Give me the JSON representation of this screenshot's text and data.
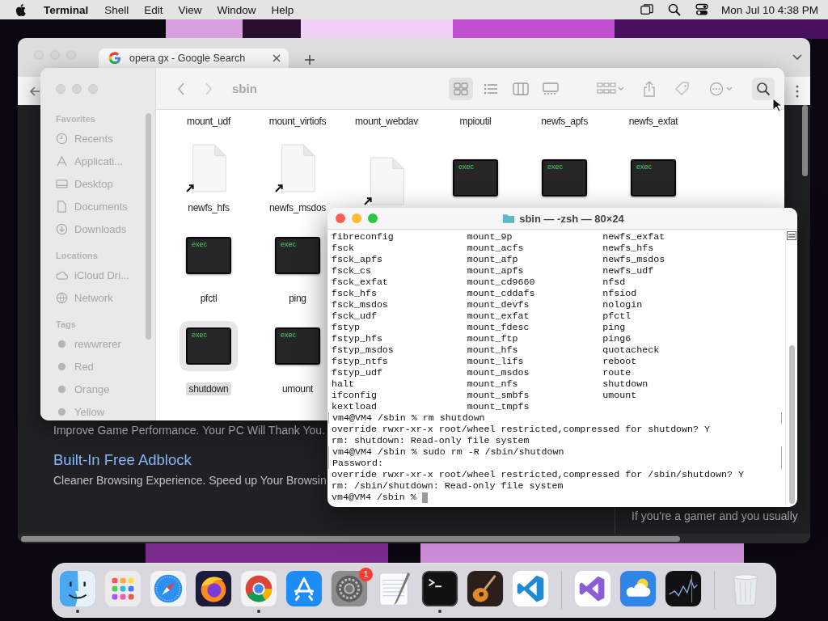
{
  "menu_bar": {
    "app_name": "Terminal",
    "menus": [
      "Shell",
      "Edit",
      "View",
      "Window",
      "Help"
    ],
    "clock": "Mon Jul 10  4:38 PM"
  },
  "browser": {
    "tab": {
      "title": "opera gx - Google Search"
    },
    "snippets": [
      {
        "kind": "text",
        "text": "Improve Game Performance. Your PC Will Thank You."
      },
      {
        "kind": "link",
        "text": "Built-In Free Adblock"
      },
      {
        "kind": "text",
        "text": "Cleaner Browsing Experience. Speed up Your Browsin"
      }
    ],
    "side_text": "If you're a gamer and you usually"
  },
  "finder": {
    "title": "sbin",
    "views": [
      {
        "kind": "grid",
        "selected": true
      },
      {
        "kind": "list",
        "selected": false
      },
      {
        "kind": "columns",
        "selected": false
      },
      {
        "kind": "gallery",
        "selected": false
      }
    ],
    "sidebar": [
      {
        "heading": "Favorites",
        "items": [
          {
            "kind": "clock",
            "label": "Recents"
          },
          {
            "kind": "apps",
            "label": "Applicati..."
          },
          {
            "kind": "desktop",
            "label": "Desktop"
          },
          {
            "kind": "document",
            "label": "Documents"
          },
          {
            "kind": "download",
            "label": "Downloads"
          }
        ]
      },
      {
        "heading": "Locations",
        "items": [
          {
            "kind": "cloud",
            "label": "iCloud Dri..."
          },
          {
            "kind": "globe",
            "label": "Network"
          }
        ]
      },
      {
        "heading": "Tags",
        "items": [
          {
            "kind": "tag",
            "label": "rewwrerer"
          },
          {
            "kind": "tag",
            "label": "Red"
          },
          {
            "kind": "tag",
            "label": "Orange"
          },
          {
            "kind": "tag",
            "label": "Yellow"
          }
        ]
      }
    ],
    "files": [
      [
        {
          "label": "mount_udf",
          "selected": false
        },
        {
          "label": "mount_virtiofs",
          "selected": false
        },
        {
          "label": "mount_webdav",
          "selected": false
        },
        {
          "label": "mpioutil",
          "selected": false
        },
        {
          "label": "newfs_apfs",
          "selected": false
        },
        {
          "label": "newfs_exfat",
          "selected": false
        }
      ],
      [
        {
          "kind": "alias",
          "label": "newfs_hfs",
          "selected": false
        },
        {
          "kind": "alias",
          "label": "newfs_msdos",
          "selected": false
        },
        {
          "kind": "alias",
          "selected": false
        },
        {
          "kind": "exec",
          "icon_text": "exec",
          "selected": false
        },
        {
          "kind": "exec",
          "icon_text": "exec",
          "selected": false
        },
        {
          "kind": "exec",
          "icon_text": "exec",
          "selected": false
        }
      ],
      [
        {
          "kind": "exec",
          "icon_text": "exec",
          "label": "pfctl",
          "selected": false
        },
        {
          "kind": "exec",
          "icon_text": "exec",
          "label": "ping",
          "selected": false
        }
      ],
      [
        {
          "kind": "exec",
          "icon_text": "exec",
          "label": "shutdown",
          "selected": true
        },
        {
          "kind": "exec",
          "icon_text": "exec",
          "label": "umount",
          "selected": false
        }
      ]
    ]
  },
  "terminal": {
    "title": "sbin — -zsh — 80×24",
    "listing": [
      [
        "fibreconfig",
        "mount_9p",
        "newfs_exfat"
      ],
      [
        "fsck",
        "mount_acfs",
        "newfs_hfs"
      ],
      [
        "fsck_apfs",
        "mount_afp",
        "newfs_msdos"
      ],
      [
        "fsck_cs",
        "mount_apfs",
        "newfs_udf"
      ],
      [
        "fsck_exfat",
        "mount_cd9660",
        "nfsd"
      ],
      [
        "fsck_hfs",
        "mount_cddafs",
        "nfsiod"
      ],
      [
        "fsck_msdos",
        "mount_devfs",
        "nologin"
      ],
      [
        "fsck_udf",
        "mount_exfat",
        "pfctl"
      ],
      [
        "fstyp",
        "mount_fdesc",
        "ping"
      ],
      [
        "fstyp_hfs",
        "mount_ftp",
        "ping6"
      ],
      [
        "fstyp_msdos",
        "mount_hfs",
        "quotacheck"
      ],
      [
        "fstyp_ntfs",
        "mount_lifs",
        "reboot"
      ],
      [
        "fstyp_udf",
        "mount_msdos",
        "route"
      ],
      [
        "halt",
        "mount_nfs",
        "shutdown"
      ],
      [
        "ifconfig",
        "mount_smbfs",
        "umount"
      ],
      [
        "kextload",
        "mount_tmpfs"
      ]
    ],
    "lines": [
      {
        "text": "vm4@VM4 /sbin % rm shutdown",
        "marked": true,
        "cursor": false
      },
      {
        "text": "override rwxr-xr-x root/wheel restricted,compressed for shutdown? Y",
        "marked": false,
        "cursor": false
      },
      {
        "text": "rm: shutdown: Read-only file system",
        "marked": false,
        "cursor": false
      },
      {
        "text": "vm4@VM4 /sbin % sudo rm -R /sbin/shutdown",
        "marked": true,
        "cursor": false
      },
      {
        "text": "Password:",
        "marked": true,
        "cursor": false
      },
      {
        "text": "override rwxr-xr-x root/wheel restricted,compressed for /sbin/shutdown? Y",
        "marked": false,
        "cursor": false
      },
      {
        "text": "rm: /sbin/shutdown: Read-only file system",
        "marked": false,
        "cursor": false
      },
      {
        "text": "vm4@VM4 /sbin %",
        "marked": false,
        "cursor": true
      }
    ]
  },
  "dock": {
    "groups": [
      [
        {
          "kind": "finder",
          "running": true
        },
        {
          "kind": "launchpad",
          "running": false
        },
        {
          "kind": "safari",
          "running": false
        },
        {
          "kind": "firefox",
          "running": false
        },
        {
          "kind": "chrome",
          "running": true
        },
        {
          "kind": "appstore",
          "running": false
        },
        {
          "kind": "settings",
          "running": false,
          "badge": "1"
        },
        {
          "kind": "textedit",
          "running": false
        },
        {
          "kind": "terminal",
          "running": true
        },
        {
          "kind": "garageband",
          "running": false
        },
        {
          "kind": "vscode",
          "running": false
        }
      ],
      [
        {
          "kind": "visualstudio",
          "running": false
        },
        {
          "kind": "weather",
          "running": false
        },
        {
          "kind": "stocks",
          "running": false
        }
      ],
      [
        {
          "kind": "trash",
          "running": false
        }
      ]
    ]
  }
}
